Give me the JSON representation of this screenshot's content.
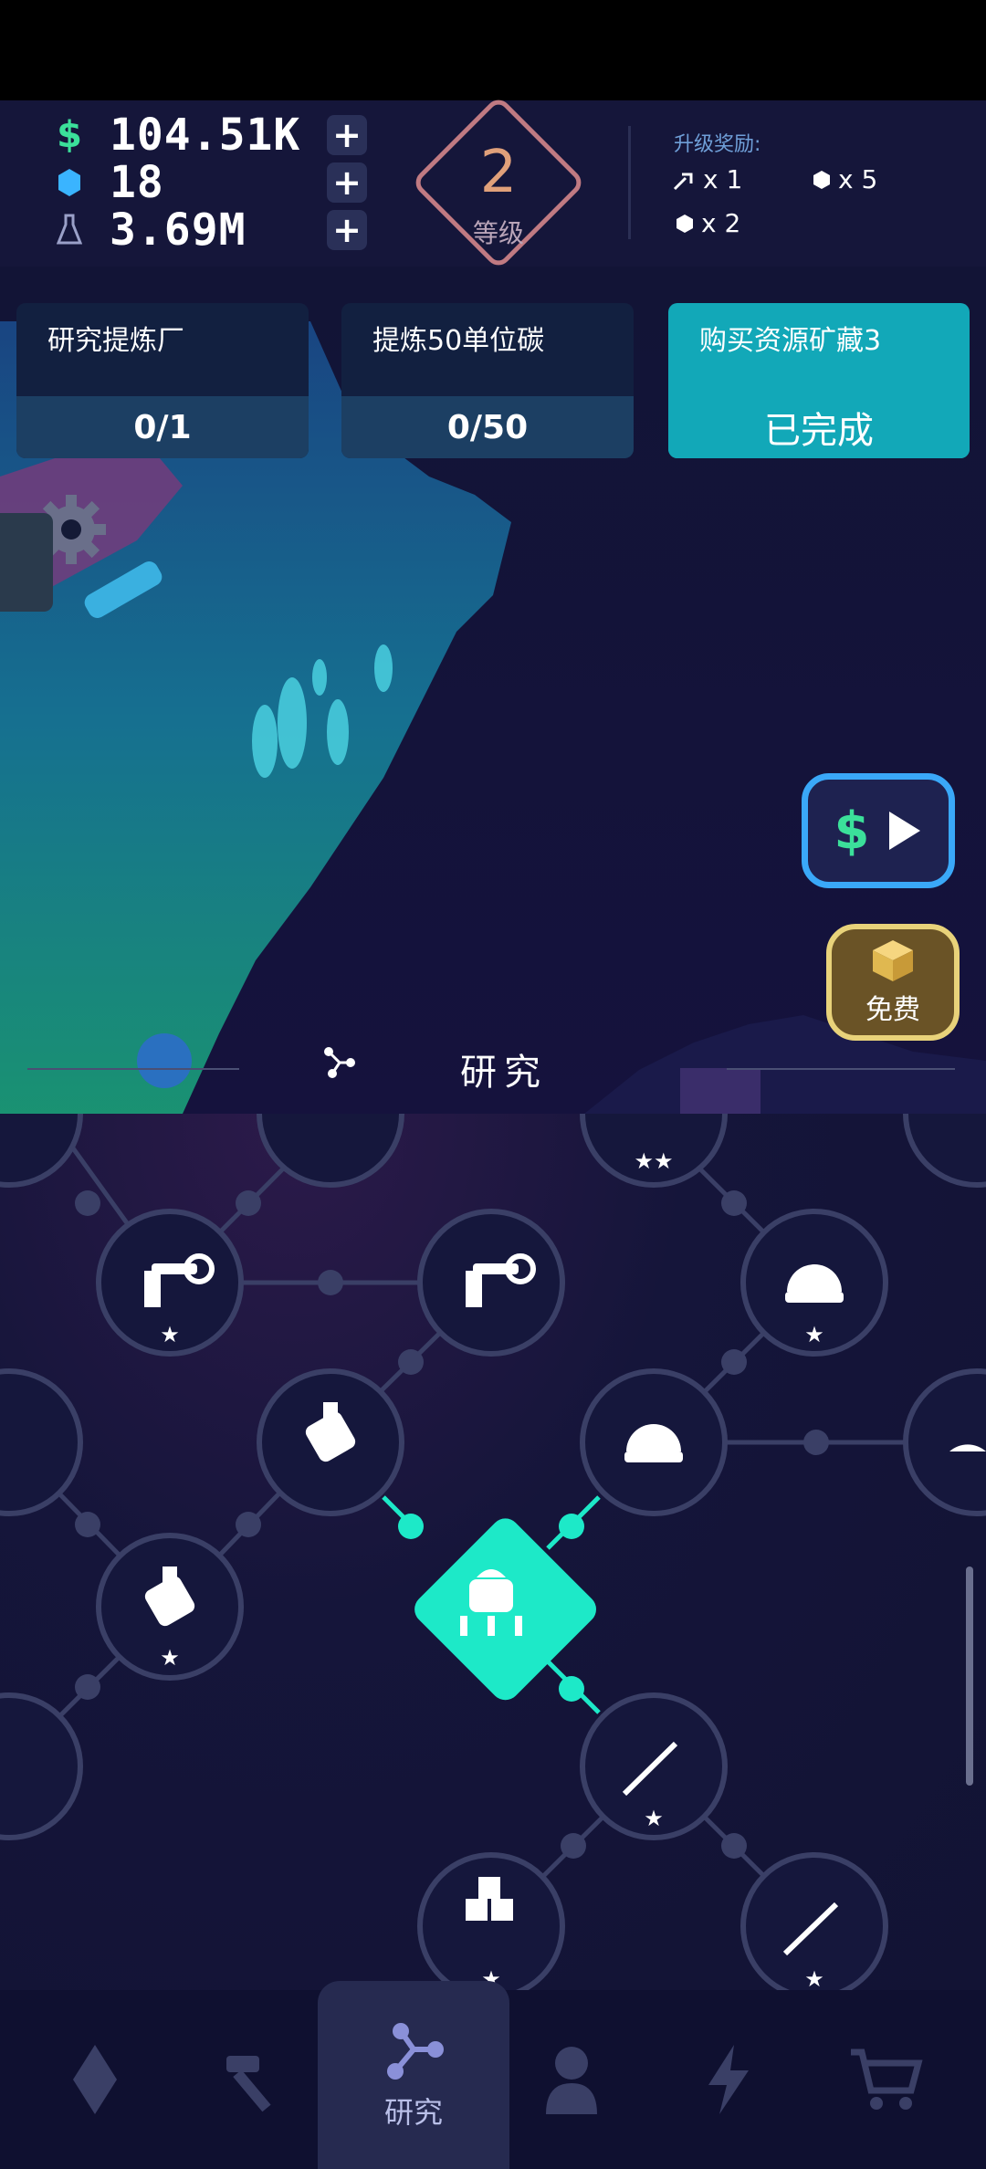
{
  "resources": {
    "cash": {
      "icon": "dollar-icon",
      "value": "104.51K",
      "color": "#3be09a"
    },
    "gems": {
      "icon": "gem-icon",
      "value": "18",
      "color": "#3ab4ff"
    },
    "science": {
      "icon": "flask-icon",
      "value": "3.69M",
      "color": "#9aa0c8"
    }
  },
  "level": {
    "number": "2",
    "label": "等级"
  },
  "rewards": {
    "title": "升级奖励:",
    "items": [
      {
        "icon": "rocket-icon",
        "text": "x 1"
      },
      {
        "icon": "gem-icon",
        "text": "x 5"
      },
      {
        "icon": "gem-icon",
        "text": "x 2"
      }
    ]
  },
  "quests": [
    {
      "title": "研究提炼厂",
      "progress": "0/1"
    },
    {
      "title": "提炼50单位碳",
      "progress": "0/50"
    },
    {
      "title": "购买资源矿藏3",
      "progress": "已完成"
    }
  ],
  "side_buttons": {
    "video": "$",
    "free": "免费"
  },
  "research": {
    "title": "研究"
  },
  "nav": {
    "research_label": "研究"
  },
  "colors": {
    "accent": "#1de9c8",
    "node_border": "#3a3f66",
    "video_border": "#3aa8f8",
    "free_border": "#e8d27a"
  }
}
